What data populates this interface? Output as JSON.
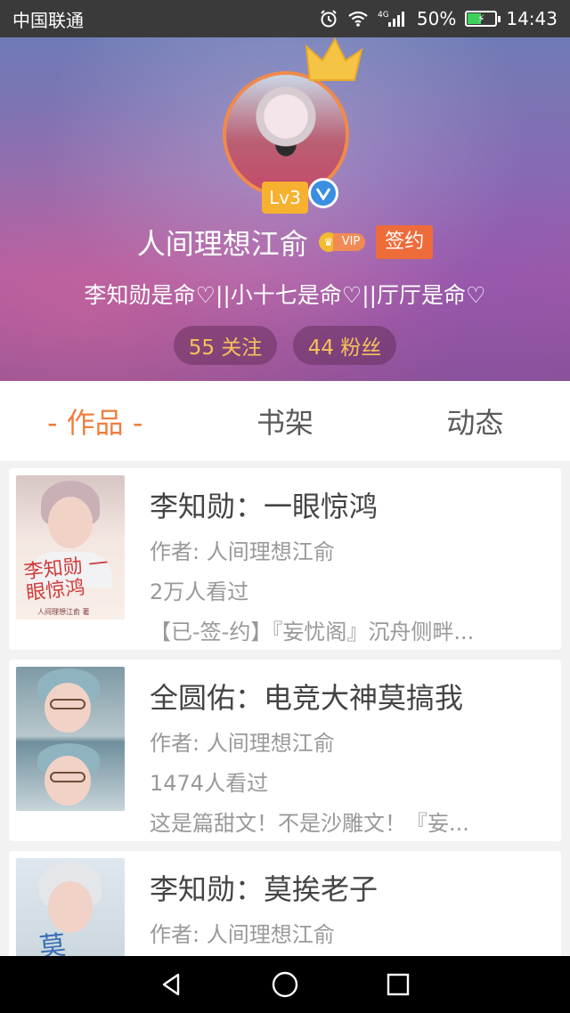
{
  "status_bar": {
    "carrier": "中国联通",
    "network": "4G",
    "battery": "50%",
    "time": "14:43"
  },
  "profile": {
    "level": "Lv3",
    "username": "人间理想江俞",
    "vip_label": "VIP",
    "contract_label": "签约",
    "bio": "李知勋是命♡||小十七是命♡||厅厅是命♡",
    "following": "55 关注",
    "fans": "44 粉丝"
  },
  "tabs": [
    {
      "label": "- 作品 -",
      "active": true
    },
    {
      "label": "书架",
      "active": false
    },
    {
      "label": "动态",
      "active": false
    }
  ],
  "books": [
    {
      "title": "李知勋：一眼惊鸿",
      "author": "作者: 人间理想江俞",
      "views": "2万人看过",
      "description": "【已-签-约】『妄忧阁』沉舟侧畔...",
      "cover_text": "李知勋 一眼惊鸿",
      "cover_small": "人间理想江俞 著"
    },
    {
      "title": "全圆佑：电竞大神莫搞我",
      "author": "作者: 人间理想江俞",
      "views": "1474人看过",
      "description": "这是篇甜文！不是沙雕文！『妄..."
    },
    {
      "title": "李知勋：莫挨老子",
      "author": "作者: 人间理想江俞",
      "cover_text": "莫"
    }
  ],
  "colors": {
    "accent": "#ef7e3f",
    "contract": "#ee6b3a",
    "stat_text": "#f6c25a",
    "verified": "#3b8ee0",
    "level": "#f5b12f"
  },
  "icons": {
    "status": [
      "alarm-icon",
      "wifi-icon",
      "signal-icon",
      "battery-icon"
    ],
    "nav": [
      "back-icon",
      "home-icon",
      "recents-icon"
    ]
  }
}
